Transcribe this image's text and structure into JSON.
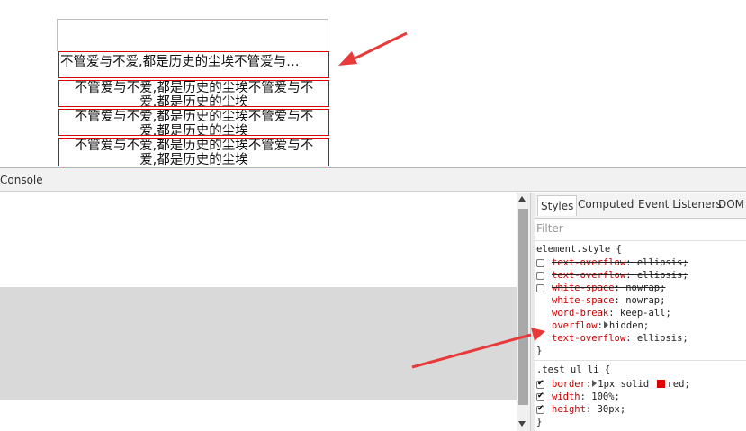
{
  "preview": {
    "item_text": "不管爱与不爱,都是历史的尘埃不管爱与不爱,都是历史的尘埃",
    "first_item_truncated": "不管爱与不爱,都是历史的尘埃不管爱与…",
    "wrapped_line1": "不管爱与不爱,都是历史的尘埃不管爱与不",
    "wrapped_line2": "爱,都是历史的尘埃"
  },
  "devtools": {
    "console_tab": "Console",
    "sidebar_tabs": [
      "Styles",
      "Computed",
      "Event Listeners",
      "DOM"
    ],
    "filter_placeholder": "Filter",
    "rule1": {
      "selector": "element.style {",
      "decls": [
        {
          "prop": "text-overflow",
          "value": "ellipsis;",
          "struck": true,
          "checkbox": "off"
        },
        {
          "prop": "text-overflow",
          "value": "ellipsis;",
          "struck": true,
          "checkbox": "off"
        },
        {
          "prop": "white-space",
          "value": "nowrap;",
          "struck": true,
          "checkbox": "off"
        },
        {
          "prop": "white-space",
          "value": "nowrap;",
          "struck": false
        },
        {
          "prop": "word-break",
          "value": "keep-all;",
          "struck": false
        },
        {
          "prop": "overflow",
          "value": "hidden;",
          "struck": false,
          "expand": true
        },
        {
          "prop": "text-overflow",
          "value": "ellipsis;",
          "struck": false
        }
      ],
      "close": "}"
    },
    "rule2": {
      "selector": ".test ul li {",
      "decls": [
        {
          "prop": "border",
          "value": "1px solid ",
          "value2": "red;",
          "swatch": "#e00000",
          "expand": true
        },
        {
          "prop": "width",
          "value": "100%;"
        },
        {
          "prop": "height",
          "value": "30px;"
        }
      ],
      "close": "}"
    }
  },
  "colors": {
    "border_red": "#e00000",
    "arrow_red": "#e83a3a",
    "highlight": "#d9d9d9"
  }
}
